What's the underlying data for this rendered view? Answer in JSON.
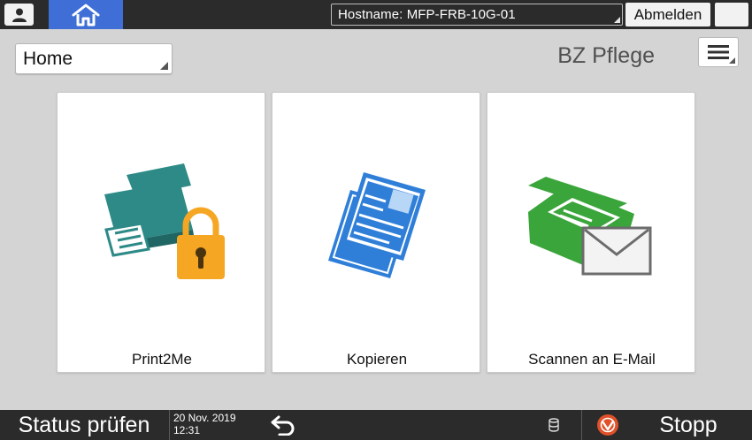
{
  "topbar": {
    "hostname": "Hostname: MFP-FRB-10G-01",
    "logout_label": "Abmelden"
  },
  "header": {
    "home_select_value": "Home",
    "page_title": "BZ Pflege"
  },
  "tiles": [
    {
      "label": "Print2Me",
      "icon": "printer-lock-icon"
    },
    {
      "label": "Kopieren",
      "icon": "copy-documents-icon"
    },
    {
      "label": "Scannen an E-Mail",
      "icon": "scanner-email-icon"
    }
  ],
  "bottombar": {
    "status_label": "Status prüfen",
    "date": "20 Nov. 2019",
    "time": "12:31",
    "stop_label": "Stopp"
  },
  "colors": {
    "home_tab": "#3f6fd6",
    "printer": "#2d8a87",
    "lock": "#f5a623",
    "copy": "#2f7fd9",
    "scanner": "#3aa53a",
    "stop": "#e0512a"
  }
}
